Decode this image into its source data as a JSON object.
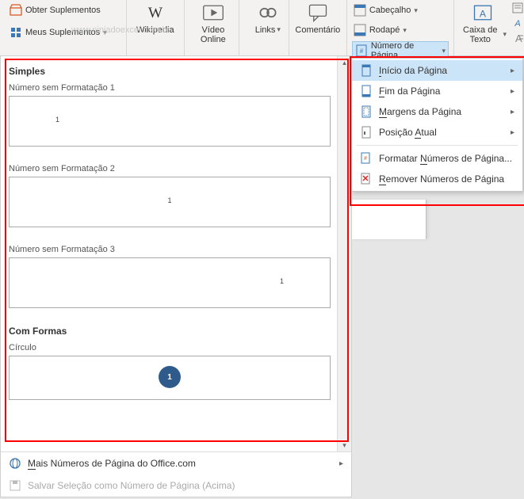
{
  "watermark": "www.ninjadoexcel.com.br",
  "ribbon": {
    "obter_suplementos": "Obter Suplementos",
    "meus_suplementos": "Meus Suplementos",
    "wikipedia": "Wikipedia",
    "video_online": "Vídeo Online",
    "links": "Links",
    "comentario": "Comentário",
    "cabecalho": "Cabeçalho",
    "rodape": "Rodapé",
    "numero_pagina": "Número de Página",
    "caixa_texto": "Caixa de Texto"
  },
  "submenu": {
    "inicio": "Início da Página",
    "fim": "Fim da Página",
    "margens": "Margens da Página",
    "posicao": "Posição Atual",
    "formatar": "Formatar Números de Página...",
    "remover": "Remover Números de Página"
  },
  "gallery": {
    "section_simples": "Simples",
    "opt1": "Número sem Formatação 1",
    "opt2": "Número sem Formatação 2",
    "opt3": "Número sem Formatação 3",
    "section_formas": "Com Formas",
    "opt_circulo": "Círculo",
    "page_num": "1",
    "mais": "Mais Números de Página do Office.com",
    "salvar": "Salvar Seleção como Número de Página (Acima)"
  }
}
